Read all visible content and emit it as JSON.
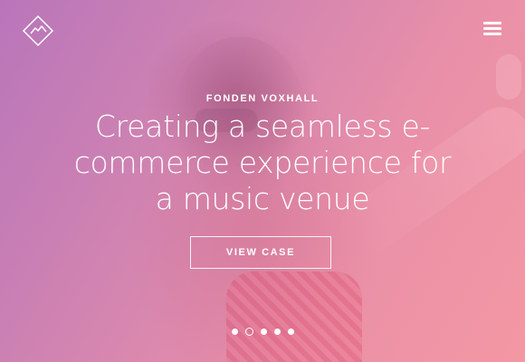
{
  "header": {
    "logo_icon": "diamond-mountain-logo-icon",
    "menu_icon": "hamburger-menu-icon"
  },
  "hero": {
    "eyebrow": "FONDEN VOXHALL",
    "headline": "Creating a seamless e-commerce experience for a music venue",
    "cta_label": "VIEW CASE"
  },
  "carousel": {
    "slide_count": 5,
    "active_index": 1
  },
  "colors": {
    "gradient_start": "#b877b8",
    "gradient_end": "#f398a2",
    "text": "#ffffff"
  }
}
